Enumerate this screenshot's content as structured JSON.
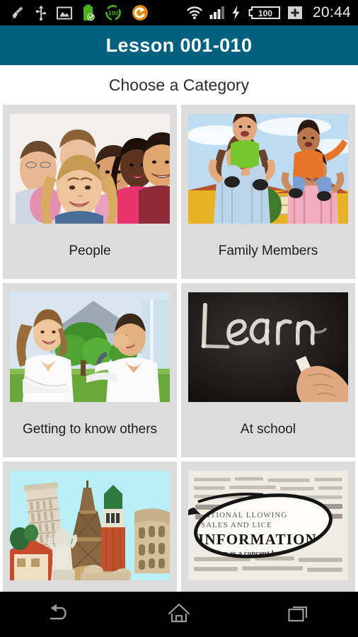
{
  "status_bar": {
    "icons_left": [
      {
        "name": "cleaner-broom-icon",
        "label": "broom"
      },
      {
        "name": "usb-icon",
        "label": "USB"
      },
      {
        "name": "gallery-image-icon",
        "label": "image"
      },
      {
        "name": "battery-charged-check-icon",
        "label": "battery charged"
      },
      {
        "name": "battery-percent-ring-icon",
        "label": "100"
      },
      {
        "name": "sync-circle-icon",
        "label": "sync"
      }
    ],
    "battery_ring_text": "100",
    "icons_right": [
      {
        "name": "wifi-icon",
        "label": "wifi"
      },
      {
        "name": "cellular-signal-icon",
        "label": "signal"
      },
      {
        "name": "charging-bolt-icon",
        "label": "charging"
      },
      {
        "name": "battery-level-icon",
        "label": "100"
      },
      {
        "name": "battery-plus-icon",
        "label": "+"
      }
    ],
    "battery_level_text": "100",
    "battery_plus_text": "+",
    "clock": "20:44"
  },
  "header": {
    "title": "Lesson 001-010",
    "background_color": "#00617f",
    "title_color": "#ffffff"
  },
  "content": {
    "subtitle": "Choose a Category",
    "card_background_color": "#dcdcdc",
    "page_background_color": "#ffffff"
  },
  "categories": [
    {
      "label": "People",
      "image_name": "group-of-smiling-young-people-photo"
    },
    {
      "label": "Family Members",
      "image_name": "family-with-children-on-shoulders-photo"
    },
    {
      "label": "Getting to know others",
      "image_name": "man-and-woman-talking-outdoors-photo"
    },
    {
      "label": "At school",
      "image_name": "blackboard-with-learn-written-in-chalk-photo"
    },
    {
      "label": "",
      "image_name": "european-landmarks-collage-photo"
    },
    {
      "label": "",
      "image_name": "eyeglass-lens-over-dictionary-information-photo"
    }
  ],
  "nav_bar": {
    "buttons": [
      {
        "name": "back-button",
        "label": "Back"
      },
      {
        "name": "home-button",
        "label": "Home"
      },
      {
        "name": "recents-button",
        "label": "Recent apps"
      }
    ],
    "icon_color": "#9a9a9a"
  }
}
